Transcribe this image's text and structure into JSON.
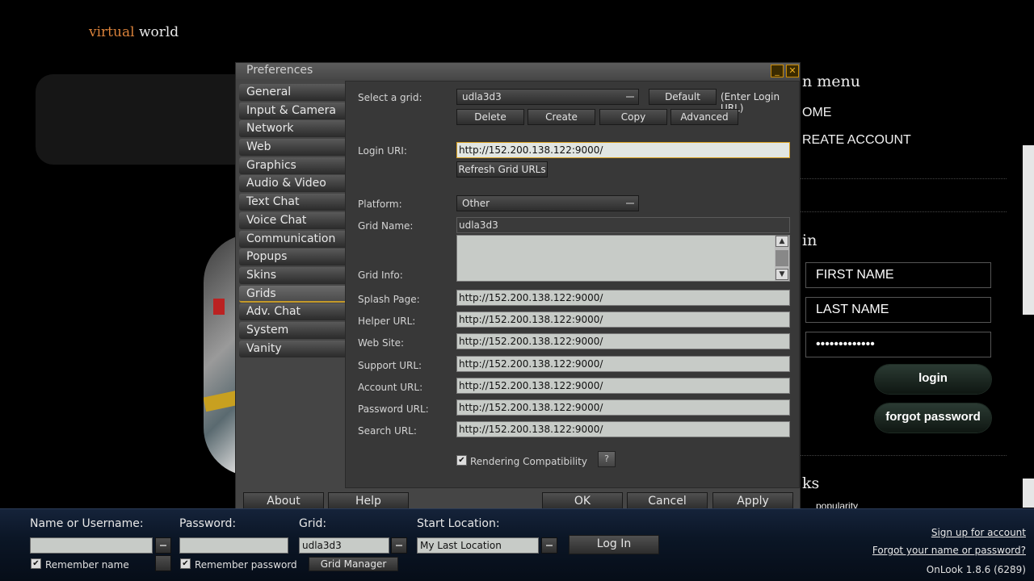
{
  "site": {
    "logo_part1": "virtual",
    "logo_part2": "world",
    "menu_heading": "n menu",
    "menu_home": "OME",
    "menu_create": "REATE ACCOUNT",
    "login_heading": "in",
    "first_name_placeholder": "FIRST NAME",
    "last_name_placeholder": "LAST NAME",
    "password_mask": "•••••••••••••",
    "login_button": "login",
    "forgot_button": "forgot password",
    "links_heading": "ks",
    "partial_text": "popularity"
  },
  "dialog": {
    "title": "Preferences",
    "minimize_icon": "_",
    "close_icon": "✕",
    "tabs": [
      {
        "label": "General"
      },
      {
        "label": "Input & Camera"
      },
      {
        "label": "Network"
      },
      {
        "label": "Web"
      },
      {
        "label": "Graphics"
      },
      {
        "label": "Audio & Video"
      },
      {
        "label": "Text Chat"
      },
      {
        "label": "Voice Chat"
      },
      {
        "label": "Communication"
      },
      {
        "label": "Popups"
      },
      {
        "label": "Skins"
      },
      {
        "label": "Grids",
        "active": true
      },
      {
        "label": "Adv. Chat"
      },
      {
        "label": "System"
      },
      {
        "label": "Vanity"
      }
    ],
    "grids": {
      "select_grid_label": "Select a grid:",
      "selected_grid": "udla3d3",
      "default_button": "Default",
      "enter_login_url": "(Enter Login URL)",
      "delete_button": "Delete",
      "create_button": "Create",
      "copy_button": "Copy",
      "advanced_button": "Advanced",
      "login_uri_label": "Login URI:",
      "login_uri_value": "http://152.200.138.122:9000/",
      "refresh_button": "Refresh Grid URLs",
      "platform_label": "Platform:",
      "platform_value": "Other",
      "grid_name_label": "Grid Name:",
      "grid_name_value": "udla3d3",
      "grid_info_label": "Grid Info:",
      "splash_label": "Splash Page:",
      "splash_value": "http://152.200.138.122:9000/",
      "helper_label": "Helper URL:",
      "helper_value": "http://152.200.138.122:9000/",
      "website_label": "Web Site:",
      "website_value": "http://152.200.138.122:9000/",
      "support_label": "Support URL:",
      "support_value": "http://152.200.138.122:9000/",
      "account_label": "Account URL:",
      "account_value": "http://152.200.138.122:9000/",
      "password_label": "Password URL:",
      "password_value": "http://152.200.138.122:9000/",
      "search_label": "Search URL:",
      "search_value": "http://152.200.138.122:9000/",
      "rendering_compat_label": "Rendering Compatibility",
      "rendering_compat_checked": true,
      "help_glyph": "?"
    },
    "footer": {
      "about_button": "About",
      "help_button": "Help",
      "ok_button": "OK",
      "cancel_button": "Cancel",
      "apply_button": "Apply"
    }
  },
  "loginbar": {
    "name_label": "Name or Username:",
    "name_value": "",
    "password_label": "Password:",
    "password_value": "",
    "grid_label": "Grid:",
    "grid_value": "udla3d3",
    "start_label": "Start Location:",
    "start_value": "My Last Location",
    "login_button": "Log In",
    "remember_name": "Remember name",
    "remember_password": "Remember password",
    "grid_manager_button": "Grid Manager",
    "signup_link": "Sign up for account",
    "forgot_link": "Forgot your name or password?",
    "version": "OnLook 1.8.6 (6289)"
  }
}
